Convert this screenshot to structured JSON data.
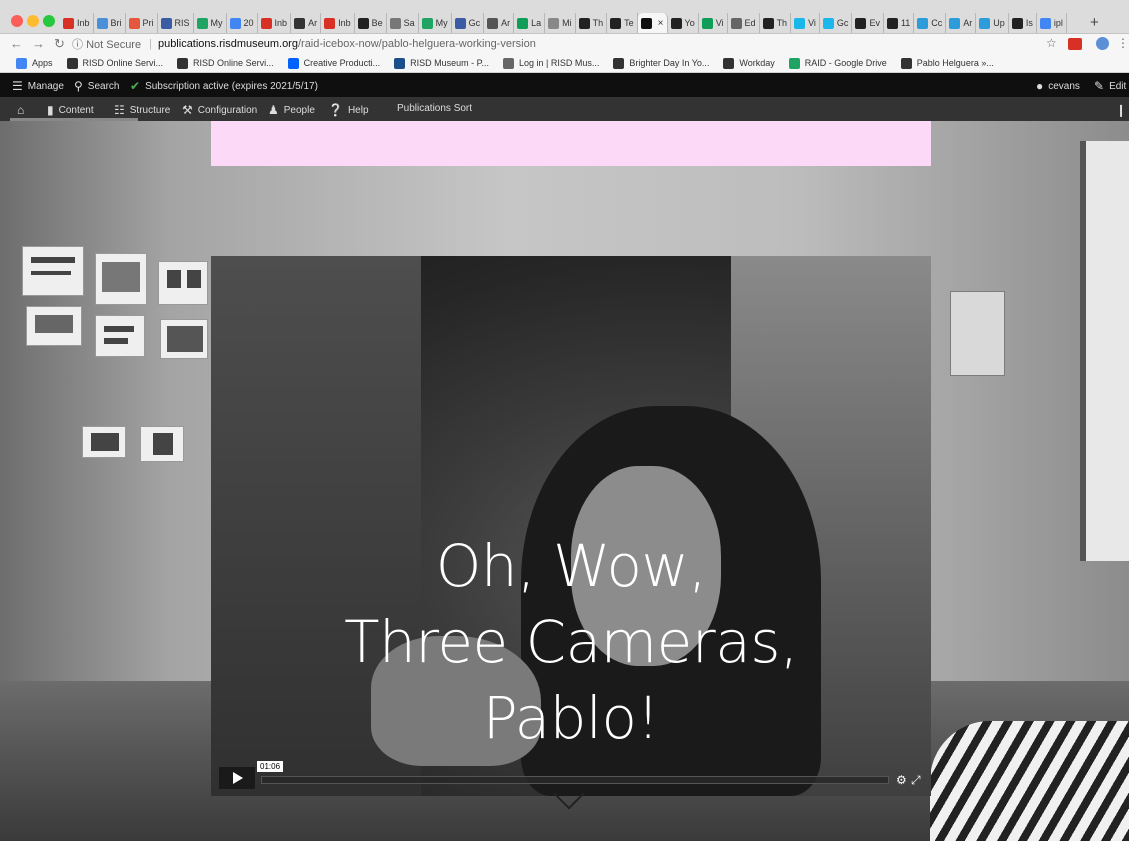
{
  "tabs": [
    {
      "label": "Inb",
      "color": "#d93025"
    },
    {
      "label": "Bri",
      "color": "#4a90d9"
    },
    {
      "label": "Pri",
      "color": "#e4573d"
    },
    {
      "label": "RIS",
      "color": "#3b5ba5"
    },
    {
      "label": "My",
      "color": "#1fa463"
    },
    {
      "label": "20",
      "color": "#4285f4"
    },
    {
      "label": "Inb",
      "color": "#d93025"
    },
    {
      "label": "Ar",
      "color": "#333333"
    },
    {
      "label": "Inb",
      "color": "#d93025"
    },
    {
      "label": "Be",
      "color": "#222222"
    },
    {
      "label": "Sa",
      "color": "#777777"
    },
    {
      "label": "My",
      "color": "#1fa463"
    },
    {
      "label": "Gc",
      "color": "#3b5ba5"
    },
    {
      "label": "Ar",
      "color": "#555555"
    },
    {
      "label": "La",
      "color": "#0f9d58"
    },
    {
      "label": "Mi",
      "color": "#888888"
    },
    {
      "label": "Th",
      "color": "#222222"
    },
    {
      "label": "Te",
      "color": "#222222"
    },
    {
      "label": "",
      "color": "#111111",
      "active": true
    },
    {
      "label": "Yo",
      "color": "#222222"
    },
    {
      "label": "Vi",
      "color": "#0f9d58"
    },
    {
      "label": "Ed",
      "color": "#666666"
    },
    {
      "label": "Th",
      "color": "#222222"
    },
    {
      "label": "Vi",
      "color": "#1ab7ea"
    },
    {
      "label": "Gc",
      "color": "#1ab7ea"
    },
    {
      "label": "Ev",
      "color": "#222222"
    },
    {
      "label": "11",
      "color": "#222222"
    },
    {
      "label": "Cc",
      "color": "#2d9cdb"
    },
    {
      "label": "Ar",
      "color": "#2d9cdb"
    },
    {
      "label": "Up",
      "color": "#2d9cdb"
    },
    {
      "label": "Is",
      "color": "#222222"
    },
    {
      "label": "ipl",
      "color": "#4285f4"
    }
  ],
  "address": {
    "security": "Not Secure",
    "host": "publications.risdmuseum.org",
    "path": "/raid-icebox-now/pablo-helguera-working-version"
  },
  "bookmarks": [
    {
      "label": "Apps",
      "color": "#4285f4"
    },
    {
      "label": "RISD Online Servi...",
      "color": "#333333"
    },
    {
      "label": "RISD Online Servi...",
      "color": "#333333"
    },
    {
      "label": "Creative Producti...",
      "color": "#0061fe"
    },
    {
      "label": "RISD Museum - P...",
      "color": "#1a4f8b"
    },
    {
      "label": "Log in | RISD Mus...",
      "color": "#666666"
    },
    {
      "label": "Brighter Day In Yo...",
      "color": "#333333"
    },
    {
      "label": "Workday",
      "color": "#333333"
    },
    {
      "label": "RAID - Google Drive",
      "color": "#1fa463"
    },
    {
      "label": "Pablo Helguera »...",
      "color": "#333333"
    }
  ],
  "admin": {
    "manage": "Manage",
    "search": "Search",
    "subscription": "Subscription active (expires 2021/5/17)",
    "user": "cevans",
    "edit": "Edit",
    "content": "Content",
    "structure": "Structure",
    "configuration": "Configuration",
    "people": "People",
    "help": "Help",
    "publications_sort": "Publications Sort"
  },
  "video": {
    "title_line1": "Oh, Wow,",
    "title_line2": "Three Cameras,",
    "title_line3": "Pablo!",
    "time": "01:06",
    "progress": 0.0
  },
  "colors": {
    "banner": "#fbd9f7",
    "subscription_check": "#4caf50"
  }
}
